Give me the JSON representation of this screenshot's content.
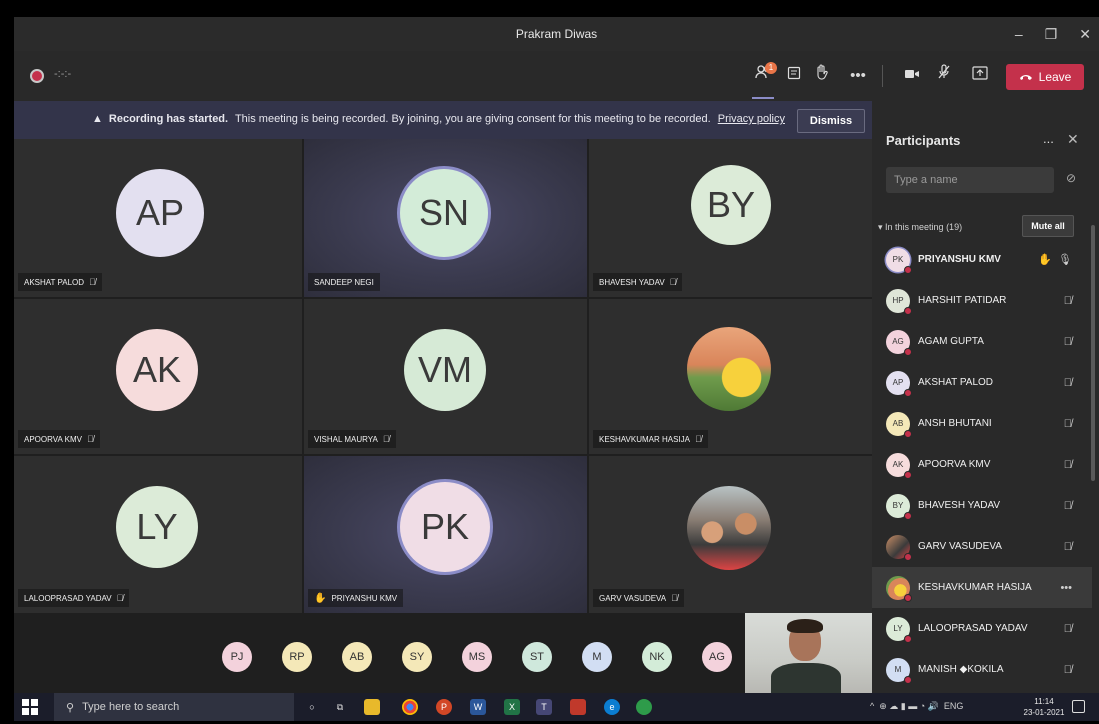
{
  "window": {
    "title": "Prakram Diwas",
    "controls": [
      "–",
      "❐",
      "✕"
    ]
  },
  "toolbar": {
    "recording_time": "-:-:-",
    "participants_badge": "1",
    "leave_label": "Leave",
    "icons": [
      "people-icon",
      "chat-icon",
      "raise-hand-icon",
      "more-icon",
      "camera-icon",
      "mic-off-icon",
      "share-screen-icon"
    ]
  },
  "banner": {
    "bold": "Recording has started.",
    "text": "This meeting is being recorded. By joining, you are giving consent for this meeting to be recorded.",
    "link": "Privacy policy",
    "dismiss_label": "Dismiss"
  },
  "tiles": [
    {
      "initials": "AP",
      "name": "AKSHAT PALOD",
      "muted": true,
      "bg": "#e3e0f0"
    },
    {
      "initials": "SN",
      "name": "SANDEEP NEGI",
      "muted": false,
      "bg": "#d3ecd8"
    },
    {
      "initials": "BY",
      "name": "BHAVESH YADAV",
      "muted": true,
      "bg": "#dcebd8"
    },
    {
      "initials": "AK",
      "name": "APOORVA KMV",
      "muted": true,
      "bg": "#f6dcdc"
    },
    {
      "initials": "VM",
      "name": "VISHAL MAURYA",
      "muted": true,
      "bg": "#d6ead6"
    },
    {
      "initials": "",
      "name": "KESHAVKUMAR HASIJA",
      "muted": true,
      "bg": "photo"
    },
    {
      "initials": "LY",
      "name": "LALOOPRASAD YADAV",
      "muted": true,
      "bg": "#dcebd8"
    },
    {
      "initials": "PK",
      "name": "PRIYANSHU KMV",
      "muted": false,
      "hand": true,
      "bg": "#f0dde6"
    },
    {
      "initials": "",
      "name": "GARV VASUDEVA",
      "muted": true,
      "bg": "photo"
    }
  ],
  "strip": [
    {
      "initials": "PJ",
      "bg": "#f3d2dc"
    },
    {
      "initials": "RP",
      "bg": "#f4e8b8"
    },
    {
      "initials": "AB",
      "bg": "#f4e8b8"
    },
    {
      "initials": "SY",
      "bg": "#f4e8b8"
    },
    {
      "initials": "MS",
      "bg": "#f3d2dc"
    },
    {
      "initials": "ST",
      "bg": "#cfe8dc"
    },
    {
      "initials": "M",
      "bg": "#d2def3"
    },
    {
      "initials": "NK",
      "bg": "#d3ecd8"
    },
    {
      "initials": "AG",
      "bg": "#f3d2dc"
    }
  ],
  "panel": {
    "title": "Participants",
    "more": "...",
    "close": "✕",
    "search_placeholder": "Type a name",
    "section": "In this meeting (19)",
    "mute_all": "Mute all",
    "participants": [
      {
        "initials": "PK",
        "name": "PRIYANSHU KMV",
        "bg": "#f0dde6",
        "state": "hand-mic",
        "bold": true
      },
      {
        "initials": "HP",
        "name": "HARSHIT PATIDAR",
        "bg": "#dfe6d8",
        "state": "muted"
      },
      {
        "initials": "AG",
        "name": "AGAM GUPTA",
        "bg": "#f3d2dc",
        "state": "muted"
      },
      {
        "initials": "AP",
        "name": "AKSHAT PALOD",
        "bg": "#e3e0f0",
        "state": "muted"
      },
      {
        "initials": "AB",
        "name": "ANSH BHUTANI",
        "bg": "#f4e8b8",
        "state": "muted"
      },
      {
        "initials": "AK",
        "name": "APOORVA KMV",
        "bg": "#f6dcdc",
        "state": "muted"
      },
      {
        "initials": "BY",
        "name": "BHAVESH YADAV",
        "bg": "#dcebd8",
        "state": "muted"
      },
      {
        "initials": "",
        "name": "GARV VASUDEVA",
        "bg": "photo",
        "state": "muted"
      },
      {
        "initials": "",
        "name": "KESHAVKUMAR HASIJA",
        "bg": "photo",
        "state": "more",
        "highlight": true
      },
      {
        "initials": "LY",
        "name": "LALOOPRASAD YADAV",
        "bg": "#dcebd8",
        "state": "muted"
      },
      {
        "initials": "M",
        "name": "MANISH ◆KOKILA",
        "bg": "#d2def3",
        "state": "muted"
      }
    ]
  },
  "taskbar": {
    "search_placeholder": "Type here to search",
    "tray_text": "ENG",
    "time": "11:14",
    "date": "23-01-2021"
  }
}
